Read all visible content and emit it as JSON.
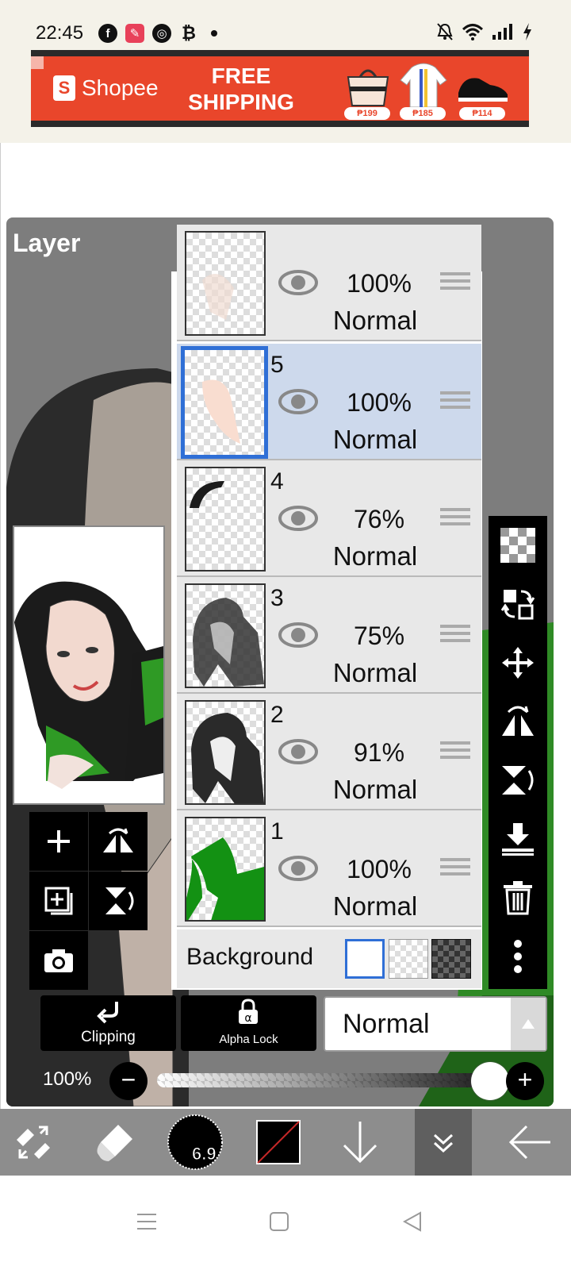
{
  "status_bar": {
    "time": "22:45",
    "left_icons": [
      "facebook-icon",
      "app-icon",
      "chrome-icon",
      "bitcoin-icon",
      "dot-icon"
    ],
    "right_icons": [
      "mute-icon",
      "wifi-icon",
      "signal-icon",
      "charging-icon"
    ]
  },
  "ad": {
    "brand": "Shopee",
    "headline_line1": "FREE",
    "headline_line2": "SHIPPING",
    "prices": [
      "₱199",
      "₱185",
      "₱114"
    ],
    "colors": {
      "background": "#e9462b"
    }
  },
  "panel": {
    "title": "Layer"
  },
  "layers": [
    {
      "number": "",
      "opacity": "100%",
      "blend": "Normal",
      "selected": false
    },
    {
      "number": "5",
      "opacity": "100%",
      "blend": "Normal",
      "selected": true
    },
    {
      "number": "4",
      "opacity": "76%",
      "blend": "Normal",
      "selected": false
    },
    {
      "number": "3",
      "opacity": "75%",
      "blend": "Normal",
      "selected": false
    },
    {
      "number": "2",
      "opacity": "91%",
      "blend": "Normal",
      "selected": false
    },
    {
      "number": "1",
      "opacity": "100%",
      "blend": "Normal",
      "selected": false
    }
  ],
  "background_row": {
    "label": "Background",
    "options": [
      "white",
      "transparent",
      "dark-checker"
    ],
    "selected": "white"
  },
  "controls": {
    "clipping_label": "Clipping",
    "alpha_lock_label": "Alpha Lock",
    "blend_mode_value": "Normal",
    "opacity_label": "100%",
    "opacity_value": 1.0
  },
  "right_toolbar": [
    "transparency-icon",
    "transfer-icon",
    "move-icon",
    "flip-horizontal-icon",
    "flip-vertical-icon",
    "merge-down-icon",
    "trash-icon",
    "more-icon"
  ],
  "left_toolbar": [
    "add-layer-icon",
    "flip-icon",
    "add-copy-icon",
    "flip-vertical-icon",
    "camera-icon"
  ],
  "bottom_toolbar": {
    "brush_size": "6.9",
    "items": [
      "transform-icon",
      "eraser-icon",
      "brush-size-icon",
      "color-icon",
      "down-arrow-icon",
      "collapse-icon",
      "back-arrow-icon"
    ]
  },
  "colors": {
    "accent": "#2f6fd6",
    "selected_row": "#cdd9ec",
    "panel_bg": "#7d7d7d",
    "toolbar_bg": "#8d8d8d"
  }
}
